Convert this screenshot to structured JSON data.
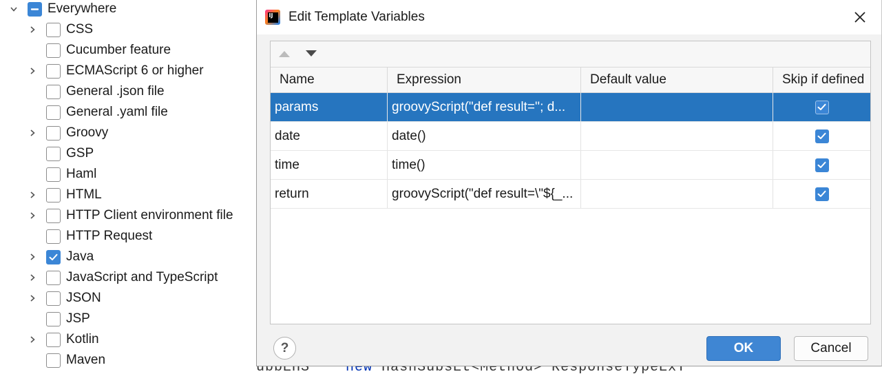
{
  "tree": {
    "items": [
      {
        "label": "Everywhere",
        "state": "partial",
        "arrow": "down",
        "level": 0
      },
      {
        "label": "CSS",
        "state": "unchecked",
        "arrow": "right",
        "level": 1
      },
      {
        "label": "Cucumber feature",
        "state": "unchecked",
        "arrow": "none",
        "level": 1
      },
      {
        "label": "ECMAScript 6 or higher",
        "state": "unchecked",
        "arrow": "right",
        "level": 1
      },
      {
        "label": "General .json file",
        "state": "unchecked",
        "arrow": "none",
        "level": 1
      },
      {
        "label": "General .yaml file",
        "state": "unchecked",
        "arrow": "none",
        "level": 1
      },
      {
        "label": "Groovy",
        "state": "unchecked",
        "arrow": "right",
        "level": 1
      },
      {
        "label": "GSP",
        "state": "unchecked",
        "arrow": "none",
        "level": 1
      },
      {
        "label": "Haml",
        "state": "unchecked",
        "arrow": "none",
        "level": 1
      },
      {
        "label": "HTML",
        "state": "unchecked",
        "arrow": "right",
        "level": 1
      },
      {
        "label": "HTTP Client environment file",
        "state": "unchecked",
        "arrow": "right",
        "level": 1
      },
      {
        "label": "HTTP Request",
        "state": "unchecked",
        "arrow": "none",
        "level": 1
      },
      {
        "label": "Java",
        "state": "checked",
        "arrow": "right",
        "level": 1
      },
      {
        "label": "JavaScript and TypeScript",
        "state": "unchecked",
        "arrow": "right",
        "level": 1
      },
      {
        "label": "JSON",
        "state": "unchecked",
        "arrow": "right",
        "level": 1
      },
      {
        "label": "JSP",
        "state": "unchecked",
        "arrow": "none",
        "level": 1
      },
      {
        "label": "Kotlin",
        "state": "unchecked",
        "arrow": "right",
        "level": 1
      },
      {
        "label": "Maven",
        "state": "unchecked",
        "arrow": "none",
        "level": 1
      }
    ]
  },
  "editor": {
    "line_fragment_a": "ubbEHS",
    "line_fragment_kw": "new",
    "line_fragment_b": "HashSubsEt&lt;Method&gt; ResponseTypeExT"
  },
  "dialog": {
    "title": "Edit Template Variables",
    "icon": "intellij-app-icon",
    "columns": [
      "Name",
      "Expression",
      "Default value",
      "Skip if defined"
    ],
    "rows": [
      {
        "name": "params",
        "expression": "groovyScript(\"def result=''; d...",
        "default": "",
        "skip": true,
        "selected": true
      },
      {
        "name": "date",
        "expression": "date()",
        "default": "",
        "skip": true,
        "selected": false
      },
      {
        "name": "time",
        "expression": "time()",
        "default": "",
        "skip": true,
        "selected": false
      },
      {
        "name": "return",
        "expression": "groovyScript(\"def result=\\\"${_...",
        "default": "",
        "skip": true,
        "selected": false
      }
    ],
    "help_label": "?",
    "ok_label": "OK",
    "cancel_label": "Cancel"
  }
}
